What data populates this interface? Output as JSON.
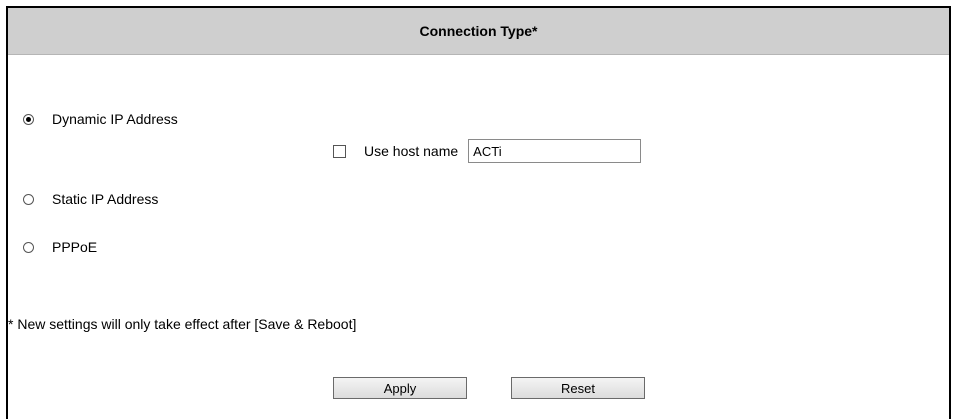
{
  "header": {
    "title": "Connection Type*"
  },
  "connection_options": [
    {
      "label": "Dynamic IP Address",
      "selected": true
    },
    {
      "label": "Static IP Address",
      "selected": false
    },
    {
      "label": "PPPoE",
      "selected": false
    }
  ],
  "host_name": {
    "checkbox_label": "Use host name",
    "checked": false,
    "value": "ACTi"
  },
  "note": "* New settings will only take effect after [Save & Reboot]",
  "buttons": {
    "apply_label": "Apply",
    "reset_label": "Reset"
  }
}
